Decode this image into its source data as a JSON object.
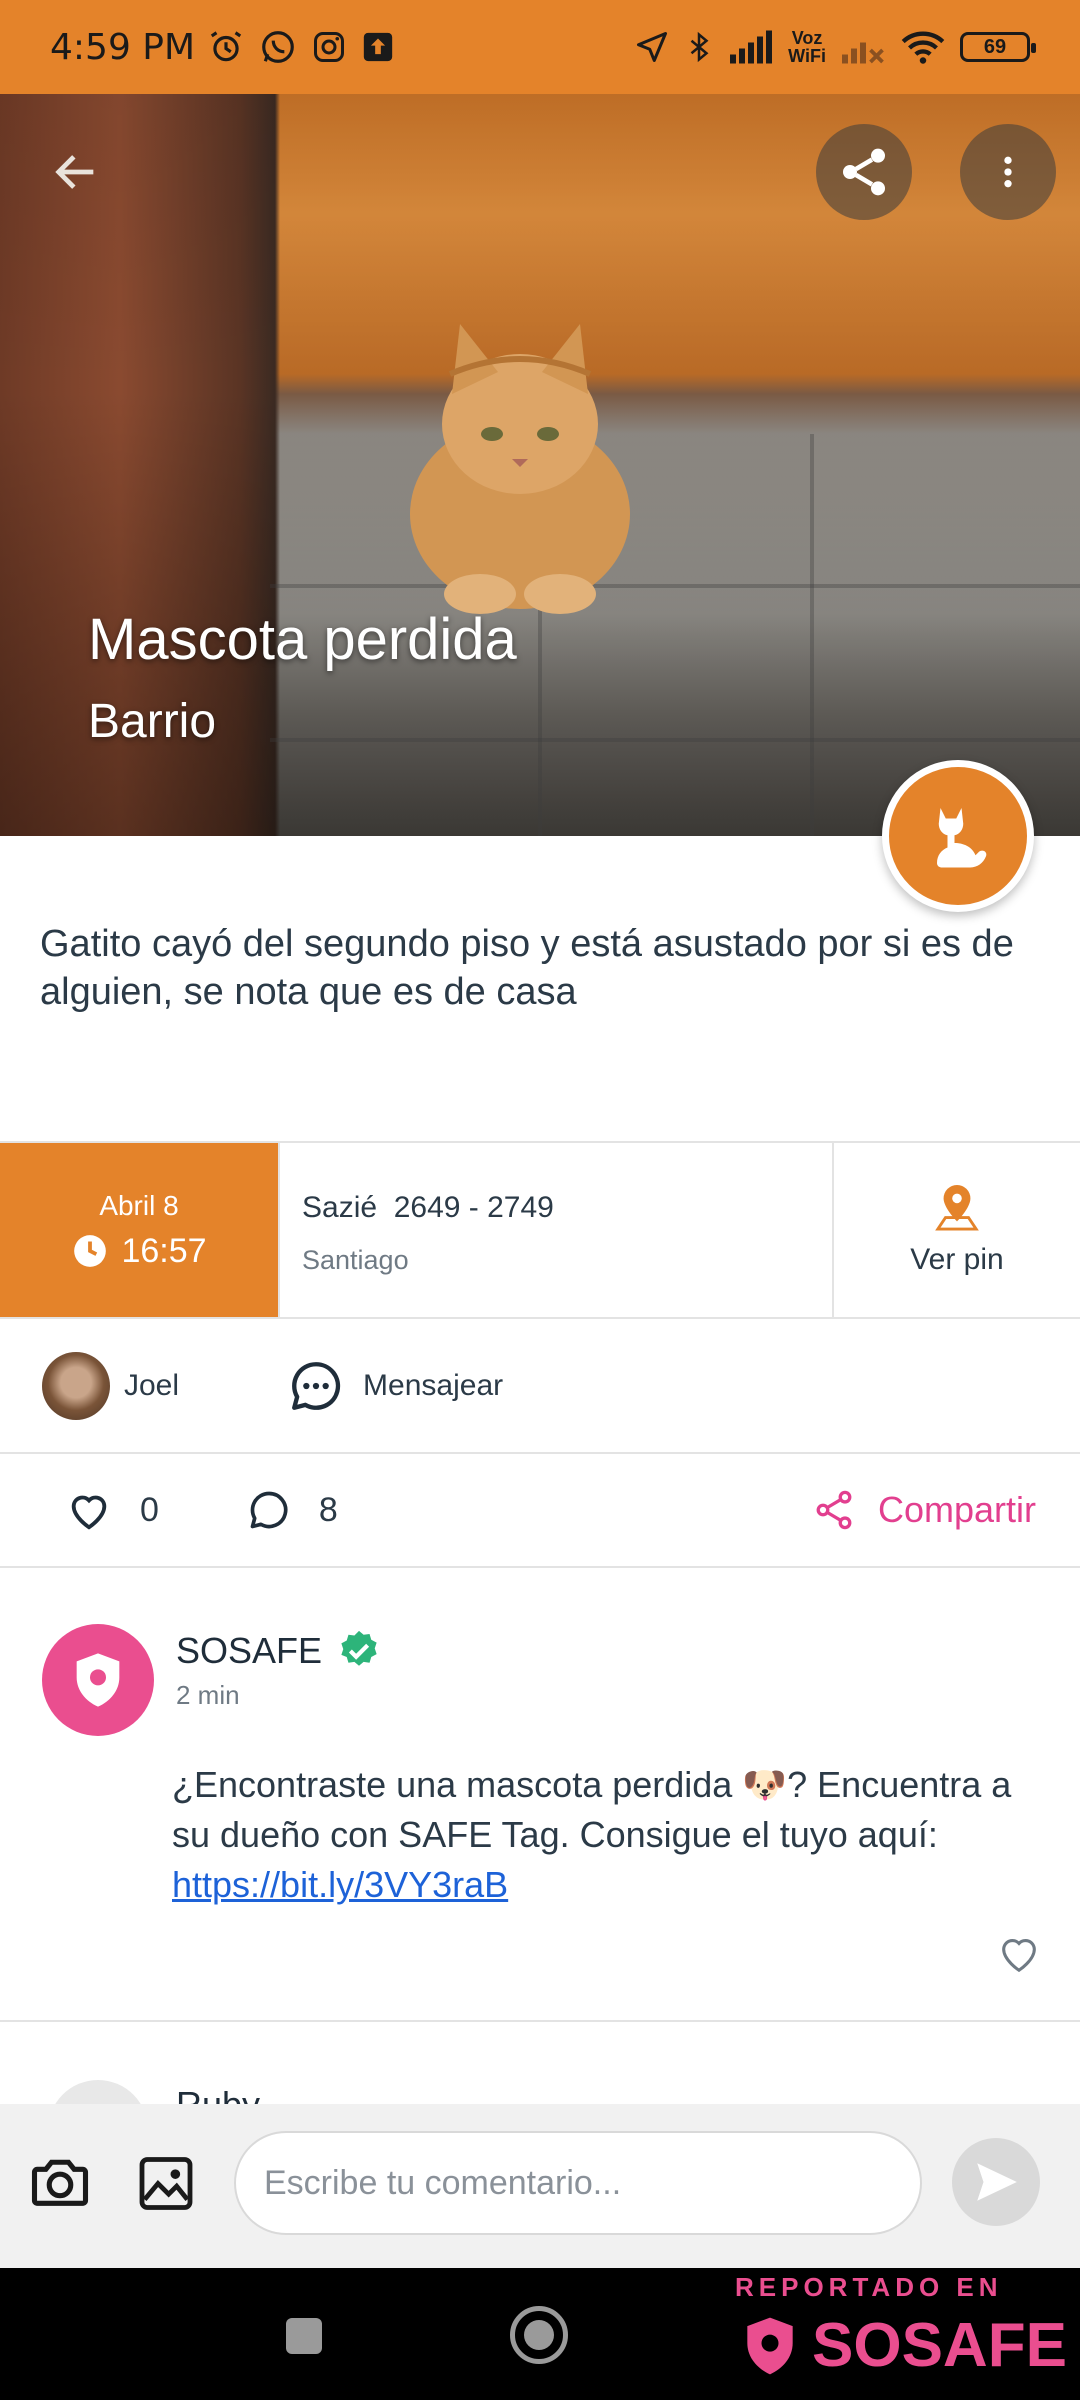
{
  "status_bar": {
    "time": "4:59 PM",
    "voz_line1": "Voz",
    "voz_line2": "WiFi",
    "battery": "69"
  },
  "hero": {
    "title": "Mascota perdida",
    "subtitle": "Barrio",
    "category_icon": "cat-icon"
  },
  "description": "Gatito cayó del segundo piso y está asustado por si es de alguien, se nota que es de casa",
  "info": {
    "date_day": "Abril 8",
    "time": "16:57",
    "street": "Sazié  2649 - 2749",
    "city": "Santiago",
    "pin_label": "Ver pin"
  },
  "user": {
    "name": "Joel",
    "message_label": "Mensajear"
  },
  "actions": {
    "likes": "0",
    "comments": "8",
    "share_label": "Compartir"
  },
  "comment": {
    "author": "SOSAFE",
    "time": "2 min",
    "text": "¿Encontraste una mascota perdida 🐶? Encuentra a su dueño con SAFE Tag. Consigue el tuyo aquí:",
    "link": "https://bit.ly/3VY3raB"
  },
  "next_comment": {
    "author": "Ruby"
  },
  "comment_bar": {
    "placeholder": "Escribe tu comentario..."
  },
  "watermark": {
    "top": "REPORTADO EN",
    "brand": "SOSAFE"
  },
  "colors": {
    "primary": "#e4832a",
    "accent": "#e23f8f",
    "brand": "#ea4e8f",
    "link": "#1d62d8"
  }
}
